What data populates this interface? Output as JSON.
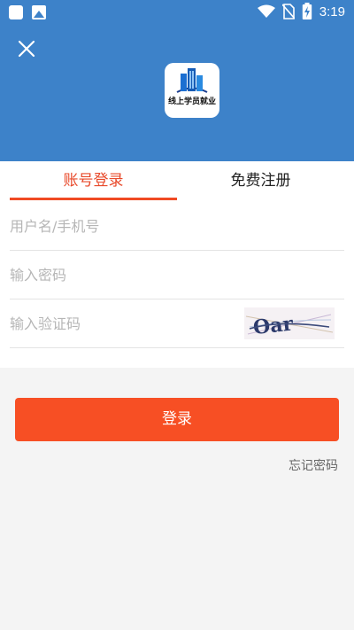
{
  "status_bar": {
    "time": "3:19",
    "icons": [
      "notification-square-icon",
      "image-notification-icon",
      "wifi-icon",
      "no-sim-icon",
      "battery-charging-icon"
    ]
  },
  "header": {
    "logo_text": "线上学员就业",
    "brand_color": "#3d82c9"
  },
  "tabs": [
    {
      "label": "账号登录",
      "active": true
    },
    {
      "label": "免费注册",
      "active": false
    }
  ],
  "form": {
    "username_placeholder": "用户名/手机号",
    "password_placeholder": "输入密码",
    "captcha_placeholder": "输入验证码",
    "captcha_text": "Oar"
  },
  "actions": {
    "login_label": "登录",
    "forgot_label": "忘记密码",
    "accent_color": "#f74f24"
  }
}
